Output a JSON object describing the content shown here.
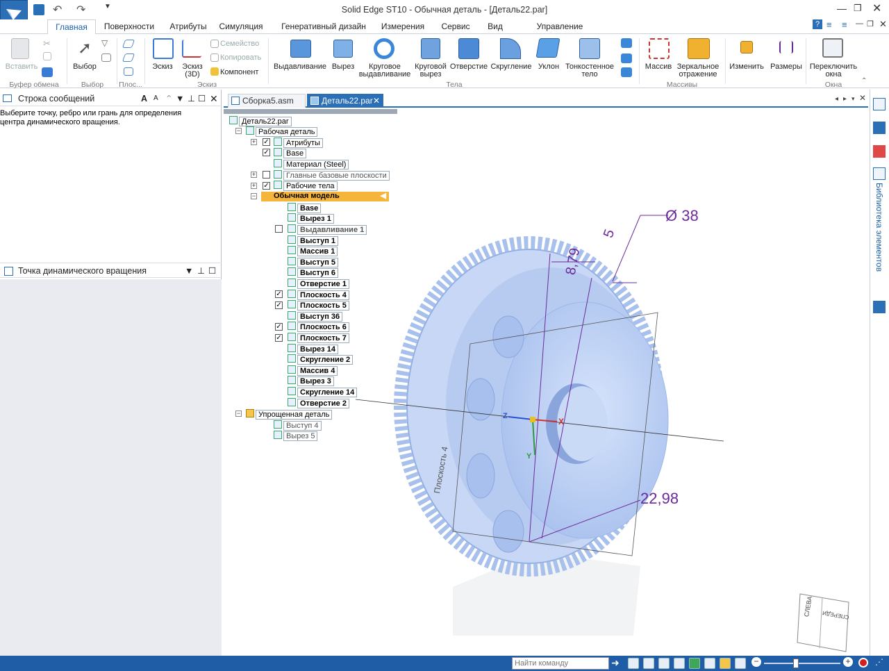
{
  "title": "Solid Edge ST10 - Обычная деталь - [Деталь22.par]",
  "ribbon_tabs": [
    "Главная",
    "Поверхности",
    "Атрибуты",
    "Симуляция",
    "Генеративный дизайн",
    "Измерения",
    "Сервис",
    "Вид",
    "Управление данными"
  ],
  "ribbon": {
    "paste": "Вставить",
    "select": "Выбор",
    "sketch": "Эскиз",
    "sketch3d_line1": "Эскиз",
    "sketch3d_line2": "(3D)",
    "family": "Семейство",
    "copy": "Копировать",
    "component": "Компонент",
    "extrude": "Выдавливание",
    "cutout": "Вырез",
    "revolve_line1": "Круговое",
    "revolve_line2": "выдавливание",
    "revcut_line1": "Круговой",
    "revcut_line2": "вырез",
    "hole": "Отверстие",
    "round": "Скругление",
    "draft": "Уклон",
    "thinwall_line1": "Тонкостенное",
    "thinwall_line2": "тело",
    "pattern": "Массив",
    "mirror_line1": "Зеркальное",
    "mirror_line2": "отражение",
    "modify": "Изменить",
    "dims": "Размеры",
    "switch_line1": "Переключить",
    "switch_line2": "окна",
    "groups": {
      "clipboard": "Буфер обмена",
      "select": "Выбор",
      "planes": "Плос...",
      "sketch": "Эскиз",
      "solids": "Тела",
      "patterns": "Массивы",
      "windows": "Окна"
    }
  },
  "left": {
    "messages_title": "Строка сообщений",
    "message_line1": "Выберите точку, ребро или грань для определения",
    "message_line2": "центра динамического вращения.",
    "pivot_title": "Точка динамического вращения"
  },
  "doc_tabs": [
    "Сборка5.asm",
    "Деталь22.par"
  ],
  "tree": {
    "root": "Деталь22.par",
    "nodes": [
      "Рабочая деталь",
      "Атрибуты",
      "Base",
      "Материал (Steel)",
      "Главные базовые плоскости",
      "Рабочие тела",
      "Обычная модель",
      "Base",
      "Вырез 1",
      "Выдавливание 1",
      "Выступ 1",
      "Массив 1",
      "Выступ 5",
      "Выступ 6",
      "Отверстие 1",
      "Плоскость 4",
      "Плоскость 5",
      "Выступ 36",
      "Плоскость 6",
      "Плоскость 7",
      "Вырез 14",
      "Скругление 2",
      "Массив 4",
      "Вырез 3",
      "Скругление 14",
      "Отверстие 2",
      "Упрощенная деталь",
      "Выступ 4",
      "Вырез 5"
    ]
  },
  "model": {
    "dim_diameter": "Ø 38",
    "dim_5": "5",
    "dim_879": "8,79",
    "dim_2298": "22,98",
    "plane_label": "Плоскость 4",
    "axis_z": "Z",
    "axis_x": "X",
    "axis_y": "Y",
    "viewcube_left": "СЛЕВА",
    "viewcube_front": "СПЕРЕДИ"
  },
  "right_panel_label": "Библиотека элементов",
  "status": {
    "search_placeholder": "Найти команду"
  },
  "colors": {
    "accent": "#2b6fb6",
    "dimension": "#6b2a9a",
    "model": "#b8cdf2",
    "selected": "#f5b53a"
  }
}
